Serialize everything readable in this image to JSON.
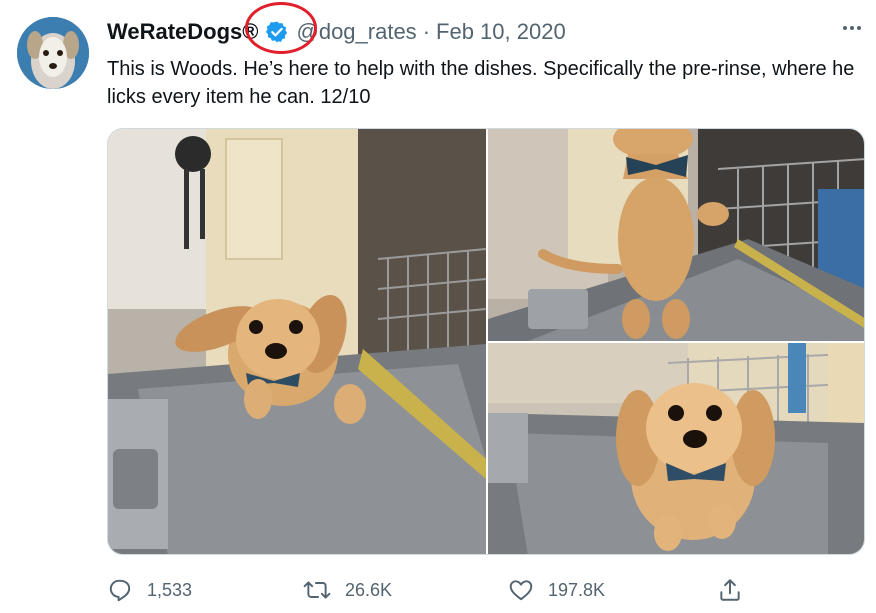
{
  "tweet": {
    "display_name": "WeRateDogs®",
    "handle": "@dog_rates",
    "separator": "·",
    "date": "Feb 10, 2020",
    "text": "This is Woods. He’s here to help with the dishes. Specifically the pre-rinse, where he licks every item he can. 12/10",
    "verified": true
  },
  "actions": {
    "replies": "1,533",
    "retweets": "26.6K",
    "likes": "197.8K"
  },
  "icons": {
    "more": "more-dots-icon",
    "reply": "reply-icon",
    "retweet": "retweet-icon",
    "like": "heart-icon",
    "share": "share-icon"
  },
  "colors": {
    "verified_blue": "#1d9bf0",
    "annotation_red": "#e0202a",
    "secondary_text": "#536471"
  }
}
